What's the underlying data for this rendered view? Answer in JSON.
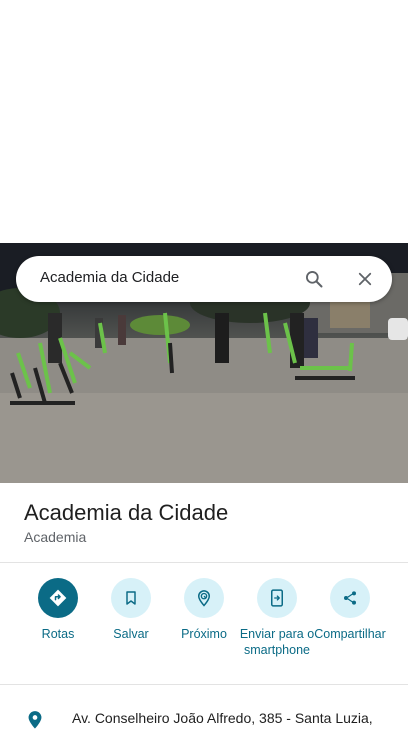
{
  "search": {
    "query": "Academia da Cidade"
  },
  "place": {
    "title": "Academia da Cidade",
    "category": "Academia"
  },
  "actions": [
    {
      "label": "Rotas",
      "icon": "directions-icon"
    },
    {
      "label": "Salvar",
      "icon": "bookmark-icon"
    },
    {
      "label": "Próximo",
      "icon": "nearby-icon"
    },
    {
      "label": "Enviar para o smartphone",
      "icon": "send-to-phone-icon"
    },
    {
      "label": "Compartilhar",
      "icon": "share-icon"
    }
  ],
  "address": {
    "text": "Av. Conselheiro João Alfredo, 385 - Santa Luzia,"
  },
  "colors": {
    "accent": "#0b6b86",
    "accent_light": "#d7f1f8",
    "equipment": "#6cc24a"
  }
}
